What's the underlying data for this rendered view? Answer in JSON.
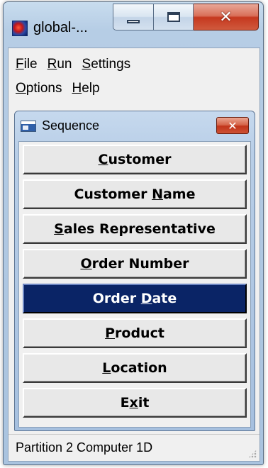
{
  "window": {
    "title": "global-...",
    "buttons": {
      "minimize": "minimize-icon",
      "maximize": "maximize-icon",
      "close": "close-icon"
    }
  },
  "menubar": {
    "items": [
      {
        "pre": "",
        "key": "F",
        "post": "ile"
      },
      {
        "pre": "",
        "key": "R",
        "post": "un"
      },
      {
        "pre": "",
        "key": "S",
        "post": "ettings"
      },
      {
        "pre": "",
        "key": "O",
        "post": "ptions"
      },
      {
        "pre": "",
        "key": "H",
        "post": "elp"
      }
    ]
  },
  "sequence_window": {
    "title": "Sequence",
    "buttons": [
      {
        "pre": "",
        "key": "C",
        "post": "ustomer",
        "active": false
      },
      {
        "pre": "Customer ",
        "key": "N",
        "post": "ame",
        "active": false
      },
      {
        "pre": "",
        "key": "S",
        "post": "ales Representative",
        "active": false
      },
      {
        "pre": "",
        "key": "O",
        "post": "rder Number",
        "active": false
      },
      {
        "pre": "Order ",
        "key": "D",
        "post": "ate",
        "active": true
      },
      {
        "pre": "",
        "key": "P",
        "post": "roduct",
        "active": false
      },
      {
        "pre": "",
        "key": "L",
        "post": "ocation",
        "active": false
      },
      {
        "pre": "E",
        "key": "x",
        "post": "it",
        "active": false
      }
    ]
  },
  "statusbar": {
    "text": "Partition 2 Computer 1D"
  },
  "colors": {
    "active_button_bg": "#0a2466",
    "close_button": "#c5381f",
    "frame": "#b6cde5"
  }
}
